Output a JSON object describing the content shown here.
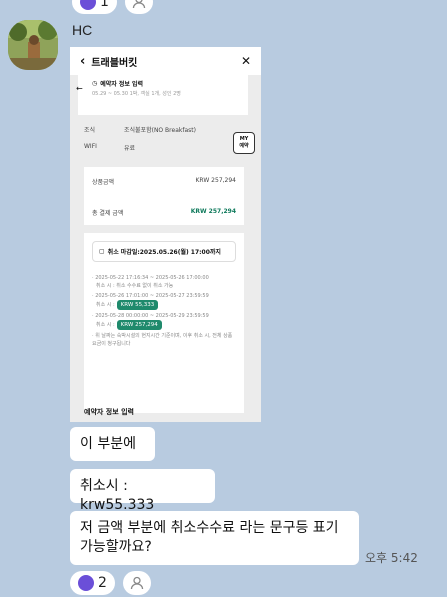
{
  "top_reactions": {
    "like_count": "1"
  },
  "sender": "HC",
  "screenshot": {
    "app_title": "트래블버킷",
    "card_title": "예약자 정보 입력",
    "card_sub": "05.29 ~ 05.30 1박, 객실 1개, 성인 2명",
    "meal_label": "조식",
    "meal_value": "조식불포함(NO Breakfast)",
    "wifi_label": "WIFI",
    "wifi_value": "유료",
    "my_badge": "MY\n예약",
    "product_label": "상품금액",
    "product_value": "KRW 257,294",
    "total_label": "총 결제 금액",
    "total_value": "KRW 257,294",
    "deadline": "취소 마감일:2025.05.26(월) 17:00까지",
    "p1_range": "2025-05-22 17:16:34 ~ 2025-05-26 17:00:00",
    "p1_note": "취소 시 : 취소 수수료 없이 취소 가능",
    "p2_range": "2025-05-26 17:01:00 ~ 2025-05-27 23:59:59",
    "p2_note": "취소 시 :",
    "p2_fee": "KRW 55,333",
    "p3_range": "2025-05-28 00:00:00 ~ 2025-05-29 23:59:59",
    "p3_note": "취소 시 :",
    "p3_fee": "KRW 257,294",
    "footnote": "위 날짜는 숙박시설의 현지시간 기준이며, 이후 취소 시, 전체 상품요금이 청구됩니다",
    "section_title": "예약자 정보 입력"
  },
  "messages": [
    "이 부분에",
    "취소시 : krw55.333",
    "저 금액 부분에 취소수수료 라는 문구등 표기 가능할까요?"
  ],
  "time": "오후 5:42",
  "bottom_reactions": {
    "like_count": "2"
  }
}
